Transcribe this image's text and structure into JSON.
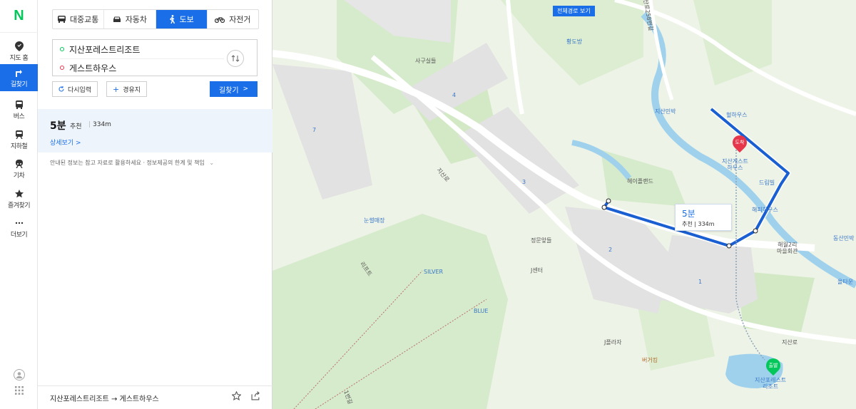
{
  "rail": {
    "logo": "N",
    "items": [
      {
        "label": "지도 홈",
        "icon": "map-pin-icon"
      },
      {
        "label": "길찾기",
        "icon": "directions-icon"
      },
      {
        "label": "버스",
        "icon": "bus-icon"
      },
      {
        "label": "지하철",
        "icon": "subway-icon"
      },
      {
        "label": "기차",
        "icon": "train-icon"
      },
      {
        "label": "즐겨찾기",
        "icon": "star-icon"
      },
      {
        "label": "더보기",
        "icon": "more-icon"
      }
    ],
    "active_index": 1
  },
  "modes": {
    "transit": "대중교통",
    "car": "자동차",
    "walk": "도보",
    "bike": "자전거",
    "active": "walk"
  },
  "route": {
    "origin": "지산포레스트리조트",
    "destination": "게스트하우스"
  },
  "buttons": {
    "multi_input": "다시입력",
    "waypoint": "경유지",
    "search": "길찾기"
  },
  "result": {
    "time": "5분",
    "recommend": "추천",
    "separator": "|",
    "distance": "334m",
    "detail": "상세보기 >"
  },
  "notice": "안내된 정보는 참고 자료로 활용하세요 · 정보제공의 한계 및 책임",
  "footer": {
    "summary": "지산포레스트리조트 → 게스트하우스"
  },
  "map": {
    "full_route_button": "전체경로 보기",
    "callout_time": "5분",
    "callout_route": "추천 | 334m",
    "destination_pin": "도착",
    "origin_pin": "출발",
    "labels": {
      "sagu": "사구실들",
      "hwangdo": "황도방",
      "jisan_minbak": "지산민박",
      "hyeolhaus": "혈하우스",
      "jisan_guesthouse": "지산게스트\n하우스",
      "dream_villa": "드림빌",
      "happy_house": "해피하우스",
      "haewol_hall": "해월2리\n마을회관",
      "dongsan_minbak": "동산민박",
      "onetown": "올타운",
      "plaza": "헤이플랜드",
      "main_gate": "정문앞들",
      "jcenter": "J센터",
      "jplaza": "J플라자",
      "burger": "버거킹",
      "nunssul": "눈썰매장",
      "silver": "SILVER",
      "blue": "BLUE",
      "jisan_resort": "지산포레스트\n리조트",
      "jisanro": "지산로",
      "jisanro2": "지산로",
      "lane": "1번길",
      "lift": "리프트",
      "road_top": "지산로258번길",
      "p1": "1",
      "p2": "2",
      "p3": "3",
      "p4": "4",
      "p7": "7"
    }
  }
}
